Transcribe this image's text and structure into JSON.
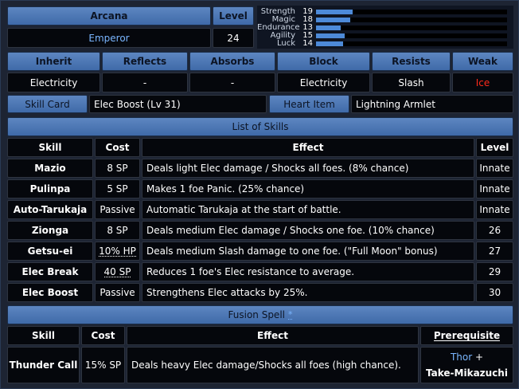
{
  "header": {
    "arcana_label": "Arcana",
    "arcana_value": "Emperor",
    "level_label": "Level",
    "level_value": "24"
  },
  "stats": [
    {
      "name": "Strength",
      "value": "19",
      "level": 19
    },
    {
      "name": "Magic",
      "value": "18",
      "level": 18
    },
    {
      "name": "Endurance",
      "value": "13",
      "level": 13
    },
    {
      "name": "Agility",
      "value": "15",
      "level": 15
    },
    {
      "name": "Luck",
      "value": "14",
      "level": 14
    }
  ],
  "affinities": {
    "headers": [
      "Inherit",
      "Reflects",
      "Absorbs",
      "Block",
      "Resists",
      "Weak"
    ],
    "values": [
      "Electricity",
      "-",
      "-",
      "Electricity",
      "Slash",
      "Ice"
    ]
  },
  "items": {
    "skill_card_label": "Skill Card",
    "skill_card_value": "Elec Boost (Lv 31)",
    "heart_item_label": "Heart Item",
    "heart_item_value": "Lightning Armlet"
  },
  "skills": {
    "title": "List of Skills",
    "columns": [
      "Skill",
      "Cost",
      "Effect",
      "Level"
    ],
    "rows": [
      {
        "skill": "Mazio",
        "cost": "8 SP",
        "effect": "Deals light Elec damage / Shocks all foes. (8% chance)",
        "level": "Innate"
      },
      {
        "skill": "Pulinpa",
        "cost": "5 SP",
        "effect": "Makes 1 foe Panic. (25% chance)",
        "level": "Innate"
      },
      {
        "skill": "Auto-Tarukaja",
        "cost": "Passive",
        "effect": "Automatic Tarukaja at the start of battle.",
        "level": "Innate"
      },
      {
        "skill": "Zionga",
        "cost": "8 SP",
        "effect": "Deals medium Elec damage / Shocks one foe. (10% chance)",
        "level": "26"
      },
      {
        "skill": "Getsu-ei",
        "cost": "10% HP",
        "effect": "Deals medium Slash damage to one foe. (\"Full Moon\" bonus)",
        "level": "27"
      },
      {
        "skill": "Elec Break",
        "cost": "40 SP",
        "effect": "Reduces 1 foe's Elec resistance to average.",
        "level": "29"
      },
      {
        "skill": "Elec Boost",
        "cost": "Passive",
        "effect": "Strengthens Elec attacks by 25%.",
        "level": "30"
      }
    ]
  },
  "fusion": {
    "title": "Fusion Spell",
    "note_marker": "*",
    "columns": [
      "Skill",
      "Cost",
      "Effect",
      "Prerequisite"
    ],
    "row": {
      "skill": "Thunder Call",
      "cost": "15% SP",
      "effect": "Deals heavy Elec damage/Shocks all foes (high chance).",
      "prereq_1": "Thor",
      "prereq_plus": "+",
      "prereq_2": "Take-Mikazuchi"
    }
  },
  "colors": {
    "header_blue": "#4a76b5",
    "cell_black": "#05070c",
    "link_blue": "#7ab6ff",
    "weak_red": "#ff2a1a",
    "bar_blue": "#4d8ad8"
  }
}
